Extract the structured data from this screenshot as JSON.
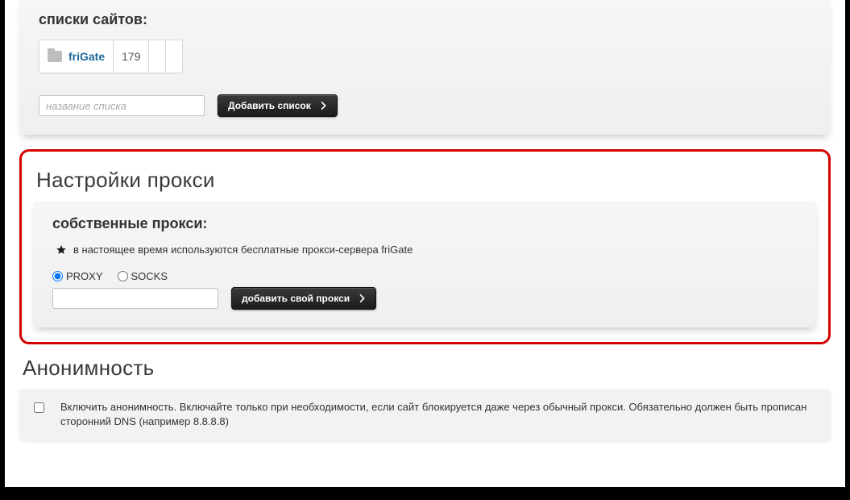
{
  "site_lists": {
    "title": "списки сайтов:",
    "entry": {
      "name": "friGate",
      "count": "179"
    },
    "name_placeholder": "название списка",
    "add_btn": "Добавить список"
  },
  "proxy": {
    "heading": "Настройки прокси",
    "sub": "собственные прокси:",
    "note": "в настоящее время используются бесплатные прокси-сервера friGate",
    "radio_proxy": "PROXY",
    "radio_socks": "SOCKS",
    "add_btn": "добавить свой прокси"
  },
  "anon": {
    "heading": "Анонимность",
    "text": "Включить анонимность. Включайте только при необходимости, если сайт блокируется даже через обычный прокси. Обязательно должен быть прописан сторонний DNS (например 8.8.8.8)"
  }
}
